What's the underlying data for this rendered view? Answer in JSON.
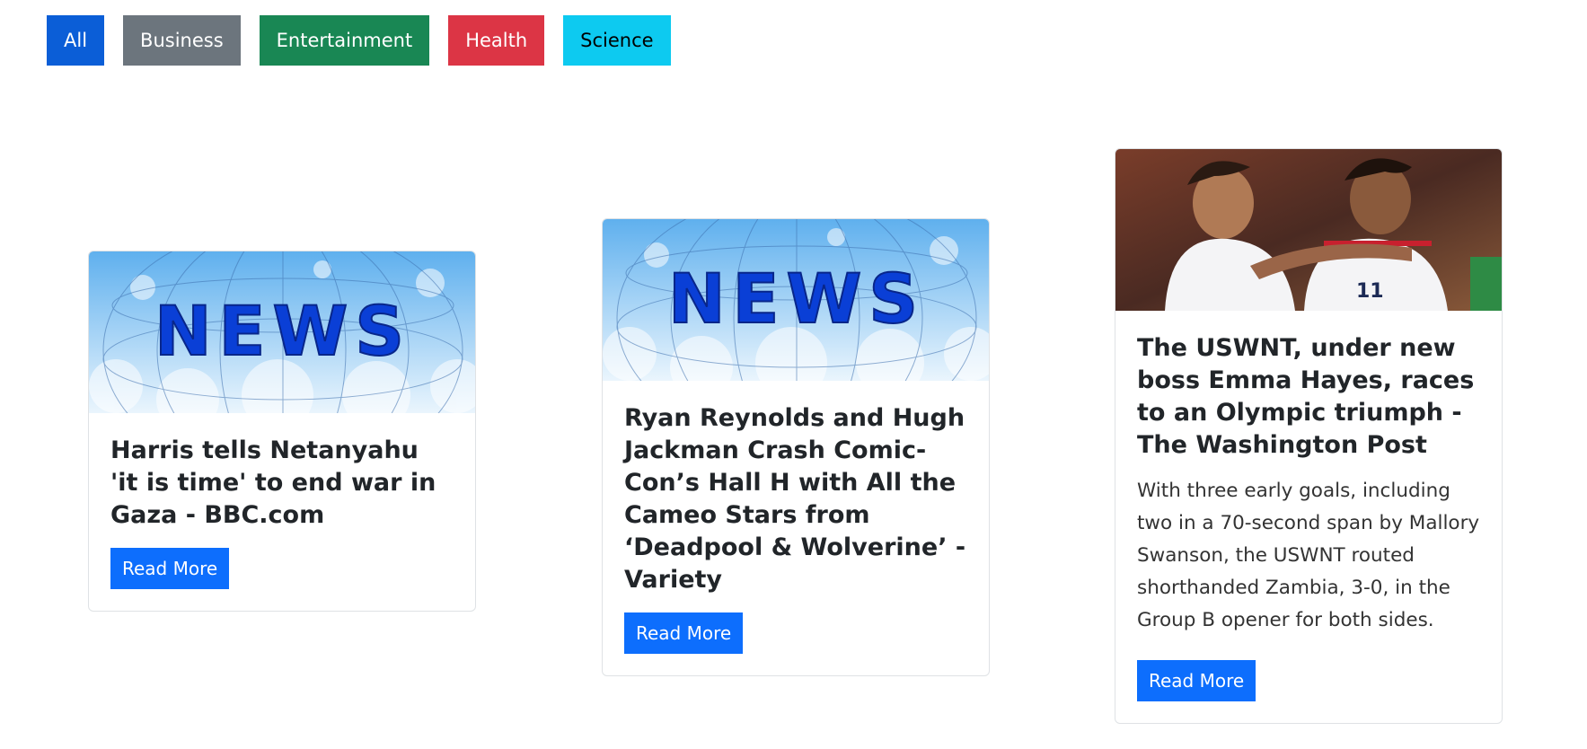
{
  "filters": {
    "all": "All",
    "business": "Business",
    "entertainment": "Entertainment",
    "health": "Health",
    "science": "Science"
  },
  "news_image_text": "NEWS",
  "cards": [
    {
      "title": "Harris tells Netanyahu 'it is time' to end war in Gaza - BBC.com",
      "button": "Read More",
      "image": "news-placeholder"
    },
    {
      "title": "Ryan Reynolds and Hugh Jackman Crash Comic-Con’s Hall H with All the Cameo Stars from ‘Deadpool & Wolverine’ - Variety",
      "button": "Read More",
      "image": "news-placeholder"
    },
    {
      "title": "The USWNT, under new boss Emma Hayes, races to an Olympic triumph - The Washington Post",
      "description": "With three early goals, including two in a 70-second span by Mallory Swanson, the USWNT routed shorthanded Zambia, 3-0, in the Group B opener for both sides.",
      "button": "Read More",
      "image": "soccer-players-photo"
    }
  ],
  "colors": {
    "primary": "#0d6efd",
    "all": "#0b5ed7",
    "business": "#6c757d",
    "entertainment": "#198754",
    "health": "#dc3545",
    "science": "#0dcaf0"
  }
}
